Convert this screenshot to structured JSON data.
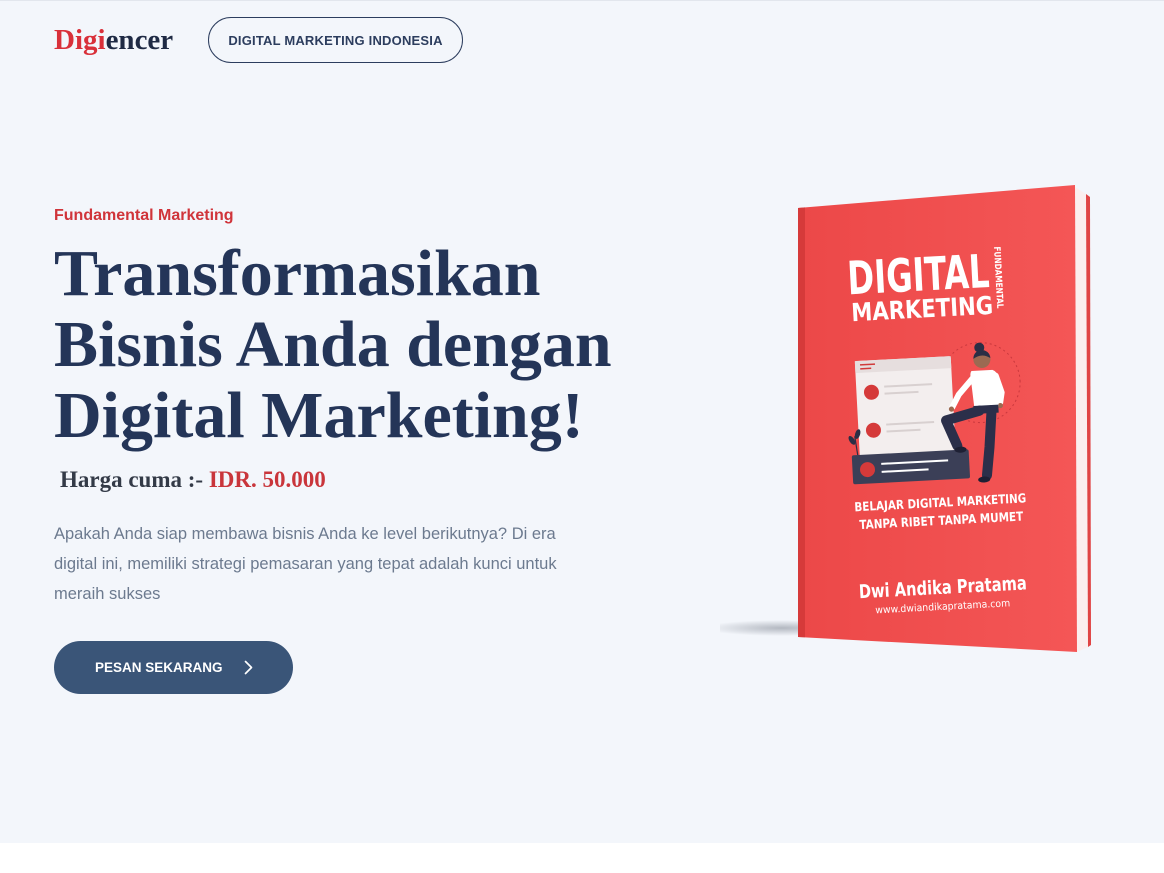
{
  "header": {
    "logo_part1": "Digi",
    "logo_part2": "encer",
    "nav_button_label": "DIGITAL MARKETING INDONESIA"
  },
  "hero": {
    "eyebrow": "Fundamental Marketing",
    "title_lines": [
      "Transformasikan",
      "Bisnis Anda dengan",
      "Digital Marketing!"
    ],
    "price_label": "Harga cuma :-",
    "price_value": "IDR. 50.000",
    "description_lines": [
      "Apakah Anda siap membawa bisnis Anda ke level berikutnya? Di era",
      "digital ini, memiliki strategi pemasaran yang tepat adalah kunci untuk",
      "meraih sukses"
    ],
    "cta_label": "PESAN SEKARANG",
    "cta_icon": "chevron-right-icon"
  },
  "book_cover": {
    "title_line1": "DIGITAL",
    "title_line2": "MARKETING",
    "title_vertical": "FUNDAMENTAL",
    "tagline_line1": "BELAJAR DIGITAL MARKETING",
    "tagline_line2": "TANPA RIBET TANPA MUMET",
    "author": "Dwi Andika Pratama",
    "website": "www.dwiandikapratama.com"
  },
  "colors": {
    "accent_red": "#d9303a",
    "headline_navy": "#243558",
    "button_blue": "#3a5578",
    "hero_background": "#f3f6fb",
    "book_cover_red": "#f24f4f"
  }
}
